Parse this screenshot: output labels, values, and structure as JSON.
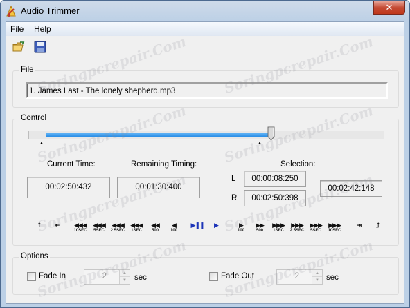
{
  "window": {
    "title": "Audio Trimmer",
    "close_glyph": "✕",
    "colors": {
      "titlebar": "#bcd0e6",
      "close": "#c44a33",
      "slider_fill": "#1f86e3",
      "play_blue": "#1d35b8"
    }
  },
  "menu": {
    "items": [
      "File",
      "Help"
    ]
  },
  "toolbar": {
    "icons": [
      "open-folder-icon",
      "save-disk-icon"
    ]
  },
  "file_group": {
    "label": "File",
    "filename": "1. James Last - The lonely shepherd.mp3"
  },
  "control_group": {
    "label": "Control",
    "slider_position": 0.68,
    "current_time_label": "Current Time:",
    "current_time": "00:02:50:432",
    "remaining_label": "Remaining Timing:",
    "remaining_time": "00:01:30:400",
    "selection_label": "Selection:",
    "l_label": "L",
    "l_time": "00:00:08:250",
    "r_label": "R",
    "r_time": "00:02:50:398",
    "selection_length": "00:02:42:148",
    "transport": [
      {
        "glyph": "⮤",
        "sub": "",
        "name": "set-left-marker-button"
      },
      {
        "glyph": "⇤",
        "sub": "",
        "name": "go-to-left-marker-button"
      },
      {
        "glyph": "◀◀◀",
        "sub": "10SEC",
        "name": "back-10sec-button"
      },
      {
        "glyph": "◀◀◀",
        "sub": "5SEC",
        "name": "back-5sec-button"
      },
      {
        "glyph": "◀◀◀",
        "sub": "2.5SEC",
        "name": "back-2.5sec-button"
      },
      {
        "glyph": "◀◀◀",
        "sub": "1SEC",
        "name": "back-1sec-button"
      },
      {
        "glyph": "◀◀",
        "sub": "500",
        "name": "back-500-button"
      },
      {
        "glyph": "◀",
        "sub": "100",
        "name": "back-100-button"
      },
      {
        "glyph": "▶❚❚",
        "sub": "",
        "name": "play-pause-button"
      },
      {
        "glyph": "▶",
        "sub": "",
        "name": "play-selection-button"
      },
      {
        "glyph": "▶",
        "sub": "100",
        "name": "forward-100-button"
      },
      {
        "glyph": "▶▶",
        "sub": "500",
        "name": "forward-500-button"
      },
      {
        "glyph": "▶▶▶",
        "sub": "1SEC",
        "name": "forward-1sec-button"
      },
      {
        "glyph": "▶▶▶",
        "sub": "2.5SEC",
        "name": "forward-2.5sec-button"
      },
      {
        "glyph": "▶▶▶",
        "sub": "5SEC",
        "name": "forward-5sec-button"
      },
      {
        "glyph": "▶▶▶",
        "sub": "10SEC",
        "name": "forward-10sec-button"
      },
      {
        "glyph": "⇥",
        "sub": "",
        "name": "go-to-right-marker-button"
      },
      {
        "glyph": "⮥",
        "sub": "",
        "name": "set-right-marker-button"
      }
    ]
  },
  "options_group": {
    "label": "Options",
    "fade_in_label": "Fade In",
    "fade_in_value": "2",
    "fade_in_unit": "sec",
    "fade_out_label": "Fade Out",
    "fade_out_value": "2",
    "fade_out_unit": "sec",
    "spin_up": "▲",
    "spin_down": "▼"
  },
  "watermark": "Soringpcrepair.Com"
}
